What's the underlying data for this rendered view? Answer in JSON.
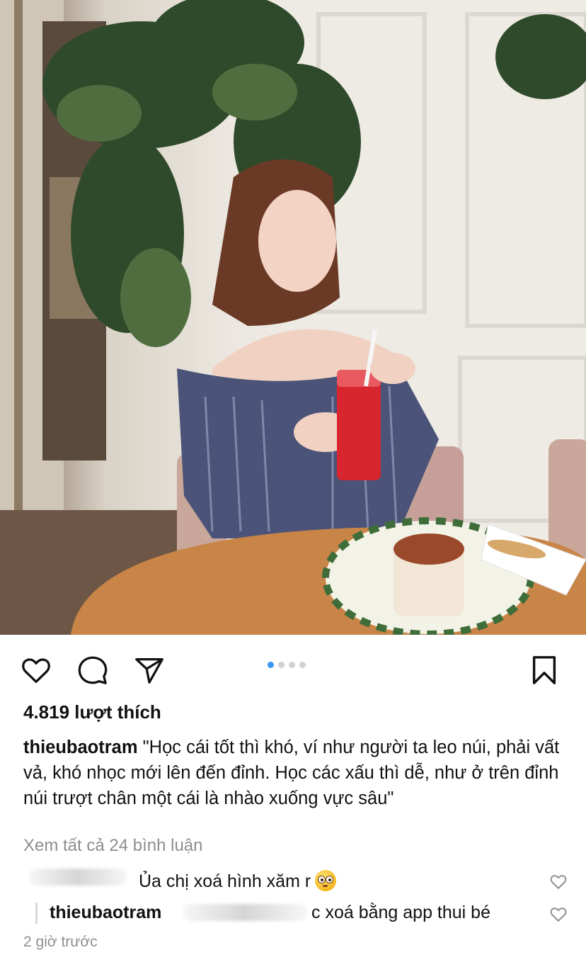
{
  "post": {
    "image": {
      "description_icon": "photo-image"
    },
    "carousel": {
      "count": 4,
      "active_index": 0,
      "active_color": "#3897f0",
      "inactive_color": "#d1d1d1"
    },
    "actions": {
      "like_icon": "heart-outline-icon",
      "comment_icon": "speech-bubble-icon",
      "share_icon": "paper-plane-icon",
      "save_icon": "bookmark-outline-icon"
    },
    "likes_text": "4.819 lượt thích",
    "caption": {
      "username": "thieubaotram",
      "text": " \"Học cái tốt thì khó, ví như người ta leo núi, phải vất vả, khó nhọc mới lên đến đỉnh. Học các xấu thì dễ, như ở trên đỉnh núi trượt chân một cái là nhào xuống vực sâu\""
    },
    "view_all_comments": "Xem tất cả 24 bình luận",
    "comments": [
      {
        "username": "",
        "text": "Ủa chị xoá hình xăm r",
        "emoji": "flushed-face-emoji",
        "like_icon": "heart-outline-small-icon"
      },
      {
        "username": "thieubaotram",
        "text": "c xoá bằng app thui bé",
        "like_icon": "heart-outline-small-icon"
      }
    ],
    "timestamp": "2 giờ trước"
  }
}
